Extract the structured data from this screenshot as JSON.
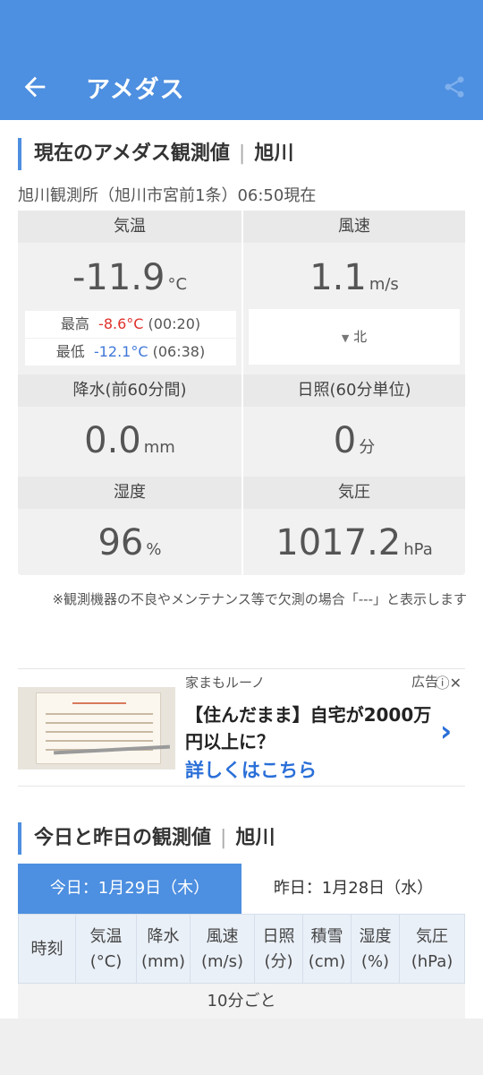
{
  "appbar": {
    "title": "アメダス",
    "back_icon": "arrow-left-icon",
    "share_icon": "share-icon"
  },
  "current": {
    "section_title": "現在のアメダス観測値",
    "location": "旭川",
    "station": "旭川観測所（旭川市宮前1条）06:50現在",
    "temperature": {
      "label": "気温",
      "value": "-11.9",
      "unit": "°C",
      "max_label": "最高",
      "max_value": "-8.6°C",
      "max_time": "(00:20)",
      "min_label": "最低",
      "min_value": "-12.1°C",
      "min_time": "(06:38)"
    },
    "wind": {
      "label": "風速",
      "value": "1.1",
      "unit": "m/s",
      "direction_arrow": "▼",
      "direction": "北"
    },
    "precip": {
      "label": "降水(前60分間)",
      "value": "0.0",
      "unit": "mm"
    },
    "sunshine": {
      "label": "日照(60分単位)",
      "value": "0",
      "unit": "分"
    },
    "humidity": {
      "label": "湿度",
      "value": "96",
      "unit": "%"
    },
    "pressure": {
      "label": "気圧",
      "value": "1017.2",
      "unit": "hPa"
    },
    "note": "※観測機器の不良やメンテナンス等で欠測の場合「---」と表示します"
  },
  "ad": {
    "sponsor": "家まもルーノ",
    "label": "広告",
    "info_icons": "ⓘ✕",
    "headline": "【住んだまま】自宅が2000万円以上に？",
    "cta": "詳しくはこちら",
    "chevron": "›"
  },
  "history": {
    "section_title": "今日と昨日の観測値",
    "location": "旭川",
    "tab_today": "今日：1月29日（木）",
    "tab_yesterday": "昨日：1月28日（水）",
    "columns": [
      {
        "line1": "時刻",
        "line2": ""
      },
      {
        "line1": "気温",
        "line2": "(°C)"
      },
      {
        "line1": "降水",
        "line2": "(mm)"
      },
      {
        "line1": "風速",
        "line2": "(m/s)"
      },
      {
        "line1": "日照",
        "line2": "(分)"
      },
      {
        "line1": "積雪",
        "line2": "(cm)"
      },
      {
        "line1": "湿度",
        "line2": "(%)"
      },
      {
        "line1": "気圧",
        "line2": "(hPa)"
      }
    ],
    "interval_label": "10分ごと"
  }
}
